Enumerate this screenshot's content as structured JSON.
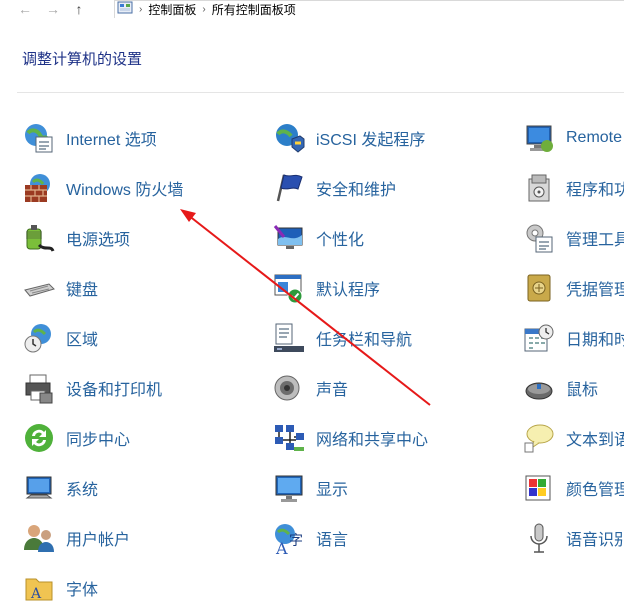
{
  "nav": {
    "back_glyph": "←",
    "forward_glyph": "→",
    "up_glyph": "↑",
    "breadcrumbs": [
      "控制面板",
      "所有控制面板项"
    ]
  },
  "page": {
    "title": "调整计算机的设置"
  },
  "items": [
    {
      "label": "Internet 选项",
      "icon": "internet-options-icon"
    },
    {
      "label": "iSCSI 发起程序",
      "icon": "iscsi-icon"
    },
    {
      "label": "Remote",
      "icon": "remoteapp-icon"
    },
    {
      "label": "Windows 防火墙",
      "icon": "firewall-icon"
    },
    {
      "label": "安全和维护",
      "icon": "flag-icon"
    },
    {
      "label": "程序和功",
      "icon": "programs-icon"
    },
    {
      "label": "电源选项",
      "icon": "power-icon"
    },
    {
      "label": "个性化",
      "icon": "personalization-icon"
    },
    {
      "label": "管理工具",
      "icon": "admin-tools-icon"
    },
    {
      "label": "键盘",
      "icon": "keyboard-icon"
    },
    {
      "label": "默认程序",
      "icon": "default-programs-icon"
    },
    {
      "label": "凭据管理",
      "icon": "credential-vault-icon"
    },
    {
      "label": "区域",
      "icon": "region-icon"
    },
    {
      "label": "任务栏和导航",
      "icon": "taskbar-icon"
    },
    {
      "label": "日期和时",
      "icon": "calendar-clock-icon"
    },
    {
      "label": "设备和打印机",
      "icon": "printer-icon"
    },
    {
      "label": "声音",
      "icon": "speaker-icon"
    },
    {
      "label": "鼠标",
      "icon": "mouse-icon"
    },
    {
      "label": "同步中心",
      "icon": "sync-icon"
    },
    {
      "label": "网络和共享中心",
      "icon": "network-icon"
    },
    {
      "label": "文本到语",
      "icon": "speech-bubble-icon"
    },
    {
      "label": "系统",
      "icon": "system-icon"
    },
    {
      "label": "显示",
      "icon": "display-icon"
    },
    {
      "label": "颜色管理",
      "icon": "color-management-icon"
    },
    {
      "label": "用户帐户",
      "icon": "user-accounts-icon"
    },
    {
      "label": "语言",
      "icon": "language-icon"
    },
    {
      "label": "语音识别",
      "icon": "microphone-icon"
    },
    {
      "label": "字体",
      "icon": "fonts-folder-icon"
    }
  ],
  "annotation": {
    "color": "#e61919"
  }
}
